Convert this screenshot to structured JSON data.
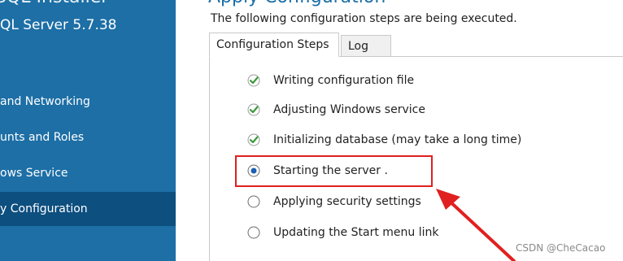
{
  "sidebar": {
    "app_title": "SQL Installer",
    "app_version": "QL Server 5.7.38",
    "items": [
      {
        "label": "and Networking",
        "active": false
      },
      {
        "label": "unts and Roles",
        "active": false
      },
      {
        "label": "ows Service",
        "active": false
      },
      {
        "label": "y Configuration",
        "active": true
      }
    ]
  },
  "main": {
    "title": "Apply Configuration",
    "subtitle": "The following configuration steps are being executed.",
    "tabs": [
      {
        "label": "Configuration Steps",
        "active": true
      },
      {
        "label": "Log",
        "active": false
      }
    ],
    "steps": [
      {
        "label": "Writing configuration file",
        "status": "done",
        "icon": "check-icon"
      },
      {
        "label": "Adjusting Windows service",
        "status": "done",
        "icon": "check-icon"
      },
      {
        "label": "Initializing database (may take a long time)",
        "status": "done",
        "icon": "check-icon"
      },
      {
        "label": "Starting the server  .",
        "status": "in-progress",
        "icon": "radio-selected-icon"
      },
      {
        "label": "Applying security settings",
        "status": "pending",
        "icon": "radio-empty-icon"
      },
      {
        "label": "Updating the Start menu link",
        "status": "pending",
        "icon": "radio-empty-icon"
      }
    ]
  },
  "annotation": {
    "highlight_color": "#e02020",
    "highlighted_step": "Starting the server  ."
  },
  "watermark": "CSDN @CheCacao",
  "colors": {
    "sidebar_bg": "#1d6fa6",
    "sidebar_active_bg": "#0d4f7f",
    "check_green": "#3a9a3a",
    "radio_blue": "#1a5fb4"
  }
}
